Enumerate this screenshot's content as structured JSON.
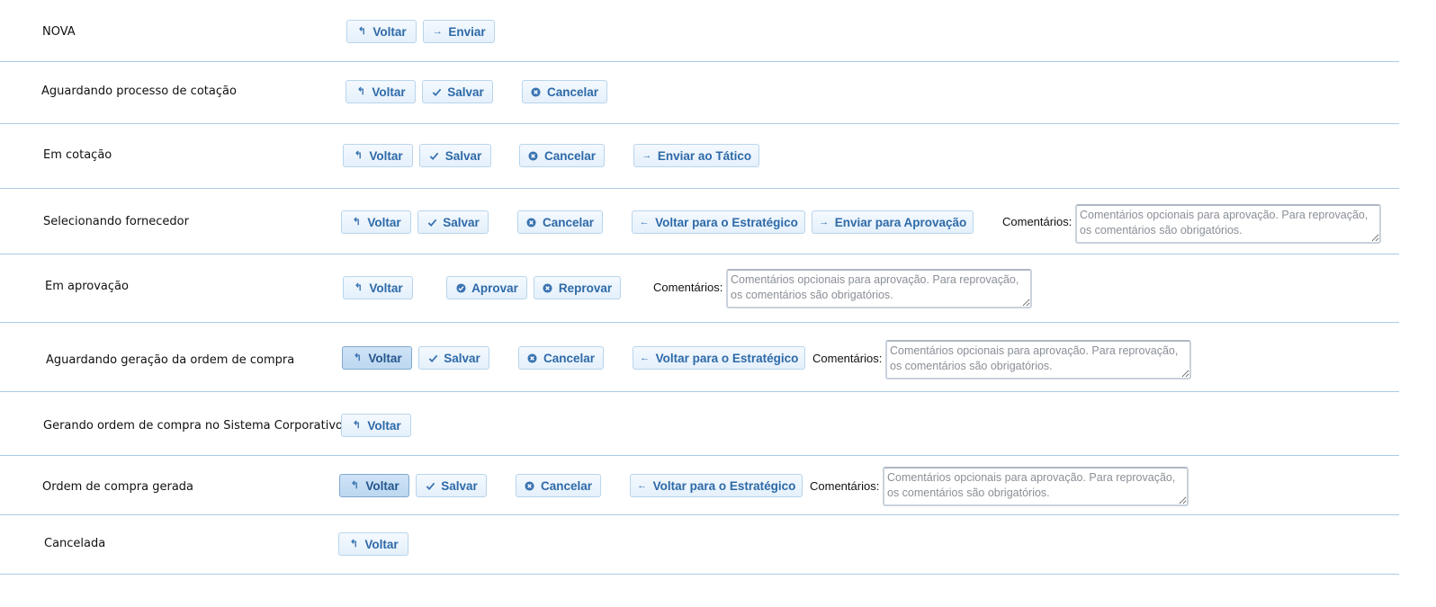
{
  "colors": {
    "accent": "#2e6aa8",
    "divider": "#a9cbe6",
    "button_bg": "#e4f0fb",
    "button_active_bg": "#bcd7f0"
  },
  "buttons": {
    "voltar": "Voltar",
    "enviar": "Enviar",
    "salvar": "Salvar",
    "cancelar": "Cancelar",
    "enviar_tatico": "Enviar ao Tático",
    "voltar_estrategico": "Voltar para o Estratégico",
    "enviar_aprovacao": "Enviar para Aprovação",
    "aprovar": "Aprovar",
    "reprovar": "Reprovar"
  },
  "comments": {
    "label": "Comentários:",
    "placeholder": "Comentários opcionais para aprovação. Para reprovação, os comentários são obrigatórios."
  },
  "statuses": [
    {
      "label": "NOVA"
    },
    {
      "label": "Aguardando processo de cotação"
    },
    {
      "label": "Em cotação"
    },
    {
      "label": "Selecionando fornecedor"
    },
    {
      "label": "Em aprovação"
    },
    {
      "label": "Aguardando geração da ordem de compra"
    },
    {
      "label": "Gerando ordem de compra no Sistema Corporativo"
    },
    {
      "label": "Ordem de compra gerada"
    },
    {
      "label": "Cancelada"
    }
  ],
  "icons": {
    "voltar": "undo-arrow-icon",
    "enviar": "right-arrow-icon",
    "salvar": "check-icon",
    "cancelar": "cancel-circle-icon",
    "voltar_estrategico": "left-arrow-icon",
    "aprovar": "check-circle-icon",
    "reprovar": "cancel-circle-icon"
  }
}
